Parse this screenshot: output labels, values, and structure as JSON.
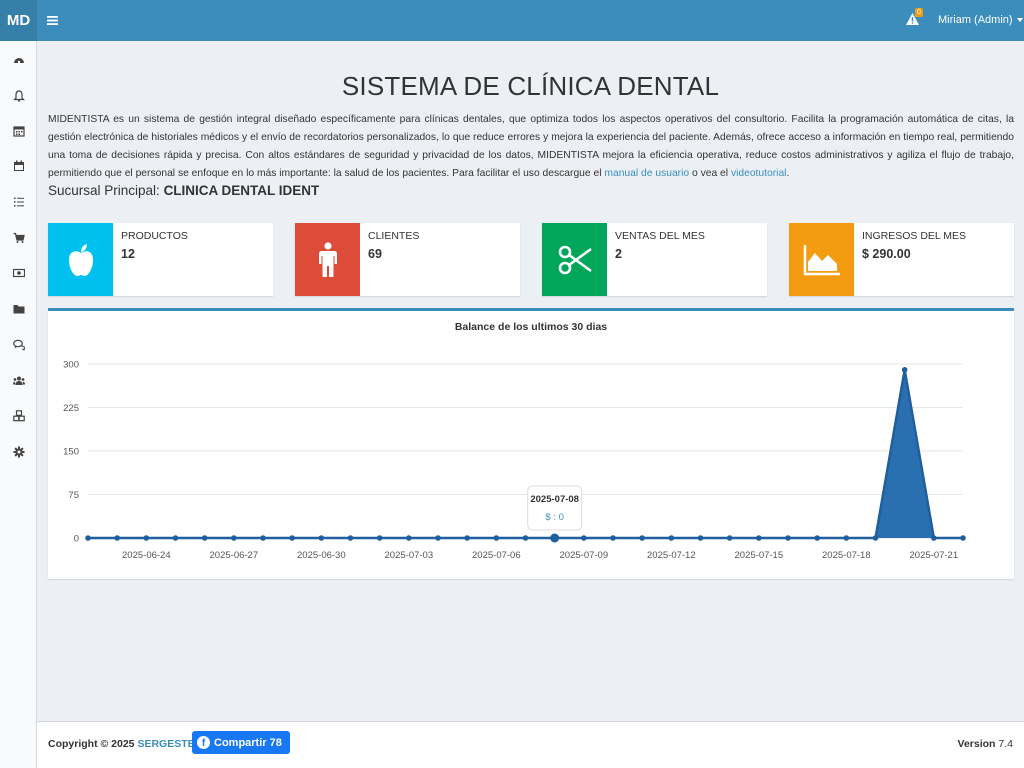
{
  "header": {
    "logo": "MD",
    "notifications_count": "0",
    "user_label": "Miriam (Admin)"
  },
  "sidebar": {
    "items": [
      {
        "icon": "dashboard-icon"
      },
      {
        "icon": "bell-icon"
      },
      {
        "icon": "calendar-icon"
      },
      {
        "icon": "calendar-alt-icon"
      },
      {
        "icon": "list-icon"
      },
      {
        "icon": "cart-icon"
      },
      {
        "icon": "money-icon"
      },
      {
        "icon": "folder-icon"
      },
      {
        "icon": "comments-icon"
      },
      {
        "icon": "users-icon"
      },
      {
        "icon": "cubes-icon"
      },
      {
        "icon": "gear-icon"
      }
    ]
  },
  "main": {
    "title": "SISTEMA DE CLÍNICA DENTAL",
    "intro_text": "MIDENTISTA es un sistema de gestión integral diseñado específicamente para clínicas dentales, que optimiza todos los aspectos operativos del consultorio. Facilita la programación automática de citas, la gestión electrónica de historiales médicos y el envío de recordatorios personalizados, lo que reduce errores y mejora la experiencia del paciente. Además, ofrece acceso a información en tiempo real, permitiendo una toma de decisiones rápida y precisa. Con altos estándares de seguridad y privacidad de los datos, MIDENTISTA mejora la eficiencia operativa, reduce costos administrativos y agiliza el flujo de trabajo, permitiendo que el personal se enfoque en lo más importante: la salud de los pacientes. Para facilitar el uso descargue el",
    "manual_link": "manual de usuario",
    "intro_mid": "o vea el",
    "video_link": "videotutorial",
    "intro_end": ".",
    "branch_label": "Sucursal Principal:",
    "branch_name": "CLINICA DENTAL IDENT"
  },
  "stats": [
    {
      "label": "PRODUCTOS",
      "value": "12",
      "color": "#00c0ef",
      "icon": "apple-icon"
    },
    {
      "label": "CLIENTES",
      "value": "69",
      "color": "#dd4b39",
      "icon": "male-icon"
    },
    {
      "label": "VENTAS DEL MES",
      "value": "2",
      "color": "#00a65a",
      "icon": "scissors-icon"
    },
    {
      "label": "INGRESOS DEL MES",
      "value": "$ 290.00",
      "color": "#f39c12",
      "icon": "area-chart-icon"
    }
  ],
  "chart_data": {
    "type": "area",
    "title": "Balance de los ultimos 30 dias",
    "xlabel": "",
    "ylabel": "",
    "ylim": [
      0,
      300
    ],
    "yticks": [
      0,
      75,
      150,
      225,
      300
    ],
    "x": [
      "2025-06-22",
      "2025-06-23",
      "2025-06-24",
      "2025-06-25",
      "2025-06-26",
      "2025-06-27",
      "2025-06-28",
      "2025-06-29",
      "2025-06-30",
      "2025-07-01",
      "2025-07-02",
      "2025-07-03",
      "2025-07-04",
      "2025-07-05",
      "2025-07-06",
      "2025-07-07",
      "2025-07-08",
      "2025-07-09",
      "2025-07-10",
      "2025-07-11",
      "2025-07-12",
      "2025-07-13",
      "2025-07-14",
      "2025-07-15",
      "2025-07-16",
      "2025-07-17",
      "2025-07-18",
      "2025-07-19",
      "2025-07-20",
      "2025-07-21",
      "2025-07-22"
    ],
    "xtick_labels": [
      "2025-06-24",
      "2025-06-27",
      "2025-06-30",
      "2025-07-03",
      "2025-07-06",
      "2025-07-09",
      "2025-07-12",
      "2025-07-15",
      "2025-07-18",
      "2025-07-21"
    ],
    "values": [
      0,
      0,
      0,
      0,
      0,
      0,
      0,
      0,
      0,
      0,
      0,
      0,
      0,
      0,
      0,
      0,
      0,
      0,
      0,
      0,
      0,
      0,
      0,
      0,
      0,
      0,
      0,
      0,
      290,
      0,
      0
    ],
    "color": "#2a6fb0",
    "grid": true,
    "tooltip": {
      "date": "2025-07-08",
      "text": "$ : 0"
    }
  },
  "footer": {
    "copyright": "Copyright © 2025",
    "company": "SERGESTEC",
    "share_label": "Compartir 78",
    "version_label": "Version",
    "version_number": "7.4"
  }
}
